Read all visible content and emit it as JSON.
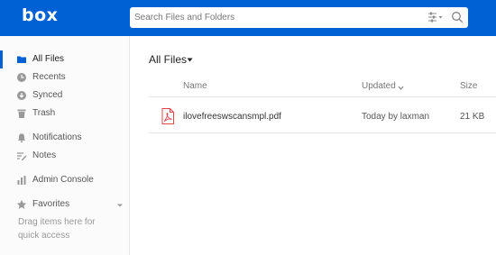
{
  "header": {
    "logo": "box",
    "search_placeholder": "Search Files and Folders",
    "brand_color": "#0061d5"
  },
  "sidebar": {
    "items": [
      {
        "label": "All Files",
        "icon": "folder-icon",
        "active": true
      },
      {
        "label": "Recents",
        "icon": "clock-icon"
      },
      {
        "label": "Synced",
        "icon": "sync-icon"
      },
      {
        "label": "Trash",
        "icon": "trash-icon"
      },
      {
        "label": "Notifications",
        "icon": "bell-icon"
      },
      {
        "label": "Notes",
        "icon": "notes-icon"
      },
      {
        "label": "Admin Console",
        "icon": "bar-chart-icon"
      },
      {
        "label": "Favorites",
        "icon": "star-icon"
      }
    ],
    "favorites_hint": "Drag items here for quick access"
  },
  "main": {
    "title": "All Files",
    "columns": {
      "name": "Name",
      "updated": "Updated",
      "size": "Size"
    },
    "files": [
      {
        "name": "ilovefreeswscansmpl.pdf",
        "updated": "Today by laxman",
        "size": "21 KB",
        "icon": "pdf-icon"
      }
    ]
  }
}
